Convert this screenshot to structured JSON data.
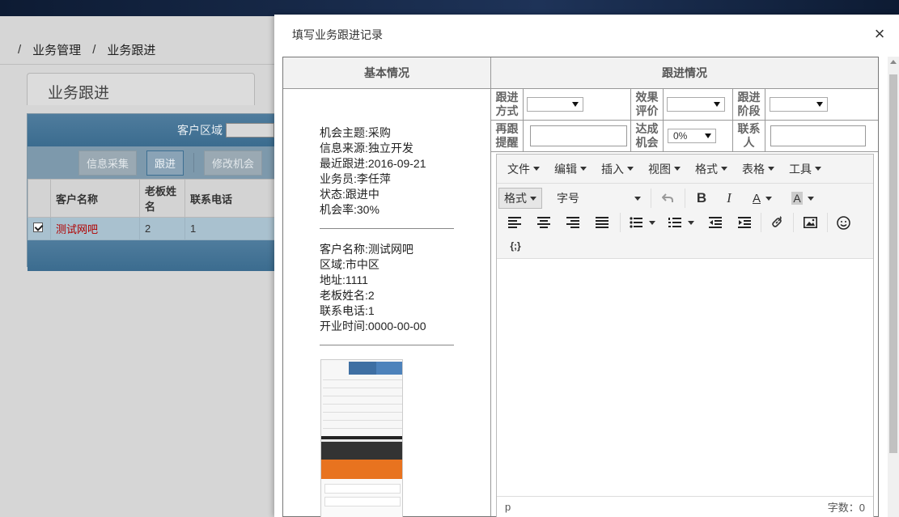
{
  "background": {
    "breadcrumb": [
      "业务管理",
      "业务跟进"
    ],
    "tab_title": "业务跟进",
    "filter_label": "客户区域",
    "toolbar_buttons": [
      "信息采集",
      "跟进",
      "修改机会"
    ],
    "table_headers": [
      "客户名称",
      "老板姓名",
      "联系电话"
    ],
    "table_rows": [
      {
        "checked": true,
        "customer": "测试网吧",
        "boss": "2",
        "phone": "1"
      }
    ]
  },
  "modal": {
    "title": "填写业务跟进记录",
    "close_glyph": "×",
    "left_header": "基本情况",
    "right_header": "跟进情况",
    "opportunity": {
      "topic": "机会主题:采购",
      "source": "信息来源:独立开发",
      "last_followup": "最近跟进:2016-09-21",
      "salesperson": "业务员:李任萍",
      "status": "状态:跟进中",
      "rate": "机会率:30%"
    },
    "customer": {
      "name": "客户名称:测试网吧",
      "area": "区域:市中区",
      "address": "地址:1111",
      "boss": "老板姓名:2",
      "phone": "联系电话:1",
      "open_time": "开业时间:0000-00-00"
    },
    "form": {
      "method_label": "跟进方式",
      "effect_label": "效果评价",
      "stage_label": "跟进阶段",
      "remind_label": "再跟提醒",
      "chance_label": "达成机会",
      "chance_value": "0%",
      "contact_label": "联系人"
    },
    "editor": {
      "menus": [
        "文件",
        "编辑",
        "插入",
        "视图",
        "格式",
        "表格",
        "工具"
      ],
      "format_label": "格式",
      "fontsize_label": "字号",
      "bold": "B",
      "italic": "I",
      "code_glyph": "{;}",
      "path": "p",
      "word_count": "字数：0"
    }
  }
}
